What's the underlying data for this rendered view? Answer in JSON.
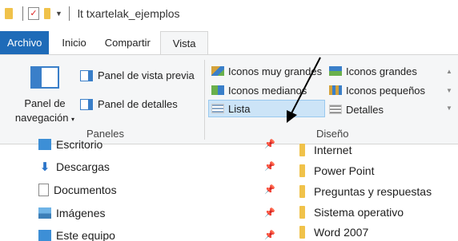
{
  "window": {
    "title": "lt txartelak_ejemplos"
  },
  "tabs": [
    {
      "label": "Archivo"
    },
    {
      "label": "Inicio"
    },
    {
      "label": "Compartir"
    },
    {
      "label": "Vista"
    }
  ],
  "ribbon": {
    "panes": {
      "navigation_label": "Panel de navegación",
      "preview_label": "Panel de vista previa",
      "details_label": "Panel de detalles",
      "group_label": "Paneles"
    },
    "layout": {
      "items": [
        {
          "label": "Iconos muy grandes",
          "icon": "extra-large-icons-icon"
        },
        {
          "label": "Iconos grandes",
          "icon": "large-icons-icon"
        },
        {
          "label": "Iconos medianos",
          "icon": "medium-icons-icon"
        },
        {
          "label": "Iconos pequeños",
          "icon": "small-icons-icon"
        },
        {
          "label": "Lista",
          "icon": "list-icon",
          "selected": true
        },
        {
          "label": "Detalles",
          "icon": "details-icon"
        }
      ],
      "group_label": "Diseño"
    }
  },
  "navigation": {
    "items": [
      {
        "label": "Escritorio",
        "icon": "desktop-icon",
        "pinned": true
      },
      {
        "label": "Descargas",
        "icon": "download-icon",
        "pinned": true
      },
      {
        "label": "Documentos",
        "icon": "document-icon",
        "pinned": true
      },
      {
        "label": "Imágenes",
        "icon": "pictures-icon",
        "pinned": true
      },
      {
        "label": "Este equipo",
        "icon": "this-pc-icon",
        "pinned": true
      }
    ]
  },
  "files": [
    {
      "name": "Internet"
    },
    {
      "name": "Power Point"
    },
    {
      "name": "Preguntas y respuestas"
    },
    {
      "name": "Sistema operativo"
    },
    {
      "name": "Word 2007"
    }
  ],
  "colors": {
    "file_tab": "#1e6bb8",
    "ribbon_bg": "#f5f6f7",
    "selection": "#cce4f7",
    "folder": "#f0c24a"
  }
}
